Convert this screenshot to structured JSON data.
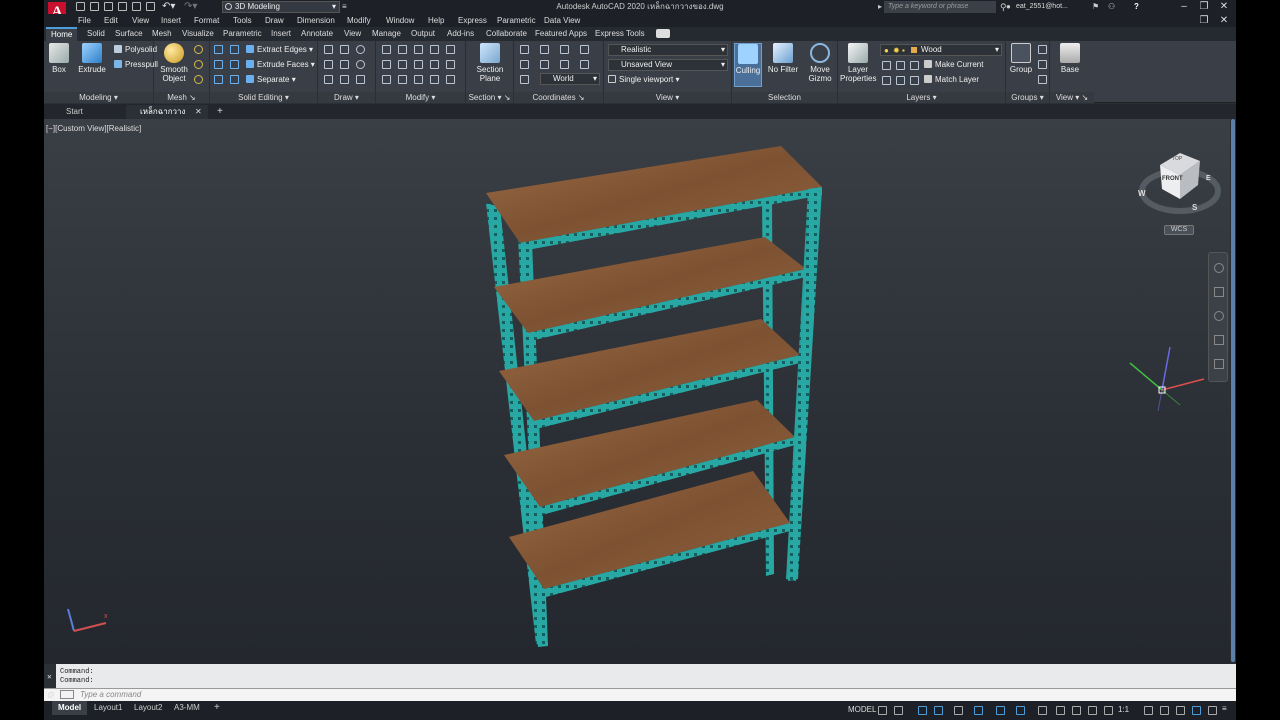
{
  "app": {
    "logo_letter": "A",
    "workspace": "3D Modeling",
    "title": "Autodesk AutoCAD 2020   เหล็กฉากวางของ.dwg",
    "search_placeholder": "Type a keyword or phrase",
    "user": "eat_2551@hot...",
    "help": "?"
  },
  "menus": [
    "File",
    "Edit",
    "View",
    "Insert",
    "Format",
    "Tools",
    "Draw",
    "Dimension",
    "Modify",
    "Window",
    "Help",
    "Express",
    "Parametric",
    "Data View"
  ],
  "ribbon_tabs": [
    "Home",
    "Solid",
    "Surface",
    "Mesh",
    "Visualize",
    "Parametric",
    "Insert",
    "Annotate",
    "View",
    "Manage",
    "Output",
    "Add-ins",
    "Collaborate",
    "Featured Apps",
    "Express Tools"
  ],
  "ribbon": {
    "modeling": {
      "label": "Modeling",
      "box": "Box",
      "extrude": "Extrude",
      "polysolid": "Polysolid",
      "presspull": "Presspull"
    },
    "mesh": {
      "label": "Mesh",
      "smooth": "Smooth",
      "object": "Object"
    },
    "solid_editing": {
      "label": "Solid Editing",
      "extract_edges": "Extract Edges",
      "extrude_faces": "Extrude Faces",
      "separate": "Separate"
    },
    "draw": {
      "label": "Draw"
    },
    "modify": {
      "label": "Modify"
    },
    "section": {
      "label": "Section",
      "section": "Section",
      "plane": "Plane"
    },
    "coordinates": {
      "label": "Coordinates",
      "world": "World"
    },
    "view": {
      "label": "View",
      "visual_style": "Realistic",
      "saved_view": "Unsaved View",
      "viewport": "Single viewport"
    },
    "selection": {
      "label": "Selection",
      "culling": "Culling",
      "no_filter": "No Filter",
      "move": "Move",
      "gizmo": "Gizmo"
    },
    "layers": {
      "label": "Layers",
      "layer": "Layer",
      "properties": "Properties",
      "current_layer": "Wood",
      "make_current": "Make Current",
      "match_layer": "Match Layer"
    },
    "groups": {
      "label": "Groups",
      "group": "Group"
    },
    "view2": {
      "label": "View",
      "base": "Base"
    }
  },
  "file_tabs": [
    "Start",
    "เหล็กฉากวางของ*"
  ],
  "viewport": {
    "label": "[−][Custom View][Realistic]",
    "viewcube_top": "TOP",
    "viewcube_front": "FRONT",
    "compass": [
      "W",
      "S",
      "E"
    ],
    "wcs": "WCS"
  },
  "command": {
    "history": [
      "Command:",
      "Command:"
    ],
    "placeholder": "Type a command"
  },
  "layout_tabs": [
    "Model",
    "Layout1",
    "Layout2",
    "A3-MM"
  ],
  "status": {
    "model": "MODEL",
    "scale": "1:1"
  },
  "colors": {
    "steel": "#27a8a4",
    "wood": "#8a5a3a",
    "accent": "#4f9dd8"
  }
}
